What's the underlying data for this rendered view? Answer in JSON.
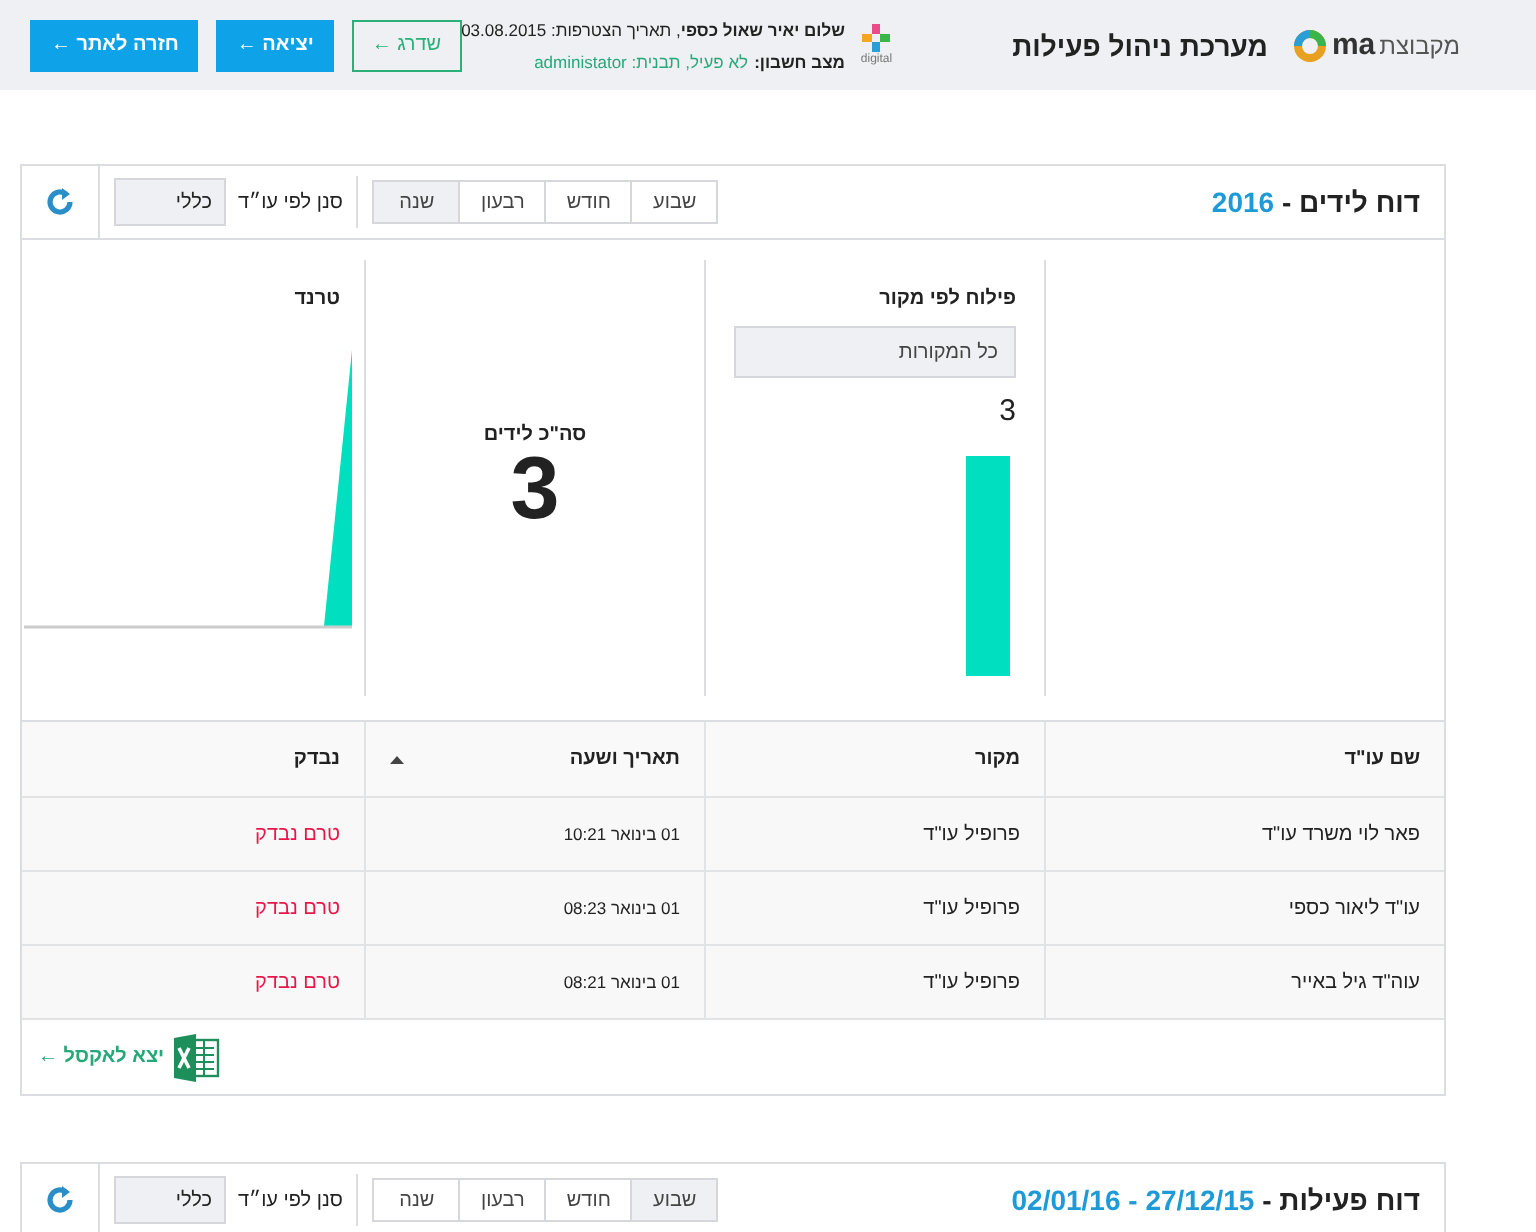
{
  "header": {
    "brand_prefix": "מקבוצת",
    "brand": "ma",
    "system_title": "מערכת ניהול פעילות",
    "partner": "digital",
    "greeting": "**שלום יאיר שאול כספי**, תאריך הצטרפות: 03.08.2015",
    "account_label": "מצב חשבון:",
    "account_value": "לא פעיל, תבנית: administator",
    "buttons": [
      {
        "label": "שדרג ←",
        "kind": "outline"
      },
      {
        "label": "יציאה ←",
        "kind": "solid"
      },
      {
        "label": "חזרה לאתר ←",
        "kind": "solid"
      }
    ]
  },
  "leads_report": {
    "title": "דוח לידים - ",
    "period": "2016",
    "tabs": [
      {
        "label": "שבוע",
        "selected": false
      },
      {
        "label": "חודש",
        "selected": false
      },
      {
        "label": "רבעון",
        "selected": false
      },
      {
        "label": "שנה",
        "selected": true
      }
    ],
    "filter_label": "סנן לפי עו״ד",
    "filter_value": "כללי",
    "by_source": {
      "title": "פילוח לפי מקור",
      "select": "כל המקורות",
      "count": "3"
    },
    "total": {
      "label": "סה\"כ לידים",
      "value": "3"
    },
    "trend": {
      "title": "טרנד"
    },
    "table": {
      "columns": [
        {
          "label": "שם עו\"ד",
          "sortable": false
        },
        {
          "label": "מקור",
          "sortable": false
        },
        {
          "label": "תאריך ושעה",
          "sortable": true
        },
        {
          "label": "נבדק",
          "sortable": false
        }
      ],
      "rows": [
        {
          "name": "פאר לוי משרד עו\"ד",
          "source": "פרופיל עו\"ד",
          "date": "01 בינואר 10:21",
          "status": "טרם נבדק"
        },
        {
          "name": "עו\"ד ליאור כספי",
          "source": "פרופיל עו\"ד",
          "date": "01 בינואר 08:23",
          "status": "טרם נבדק"
        },
        {
          "name": "עוה\"ד גיל באייר",
          "source": "פרופיל עו\"ד",
          "date": "01 בינואר 08:21",
          "status": "טרם נבדק"
        }
      ]
    },
    "export": "יצא לאקסל ←"
  },
  "activity_report": {
    "title": "דוח פעילות - ",
    "period": "27/12/15 - 02/01/16",
    "tabs": [
      {
        "label": "שבוע",
        "selected": true
      },
      {
        "label": "חודש",
        "selected": false
      },
      {
        "label": "רבעון",
        "selected": false
      },
      {
        "label": "שנה",
        "selected": false
      }
    ],
    "filter_label": "סנן לפי עו״ד",
    "filter_value": "כללי"
  }
}
